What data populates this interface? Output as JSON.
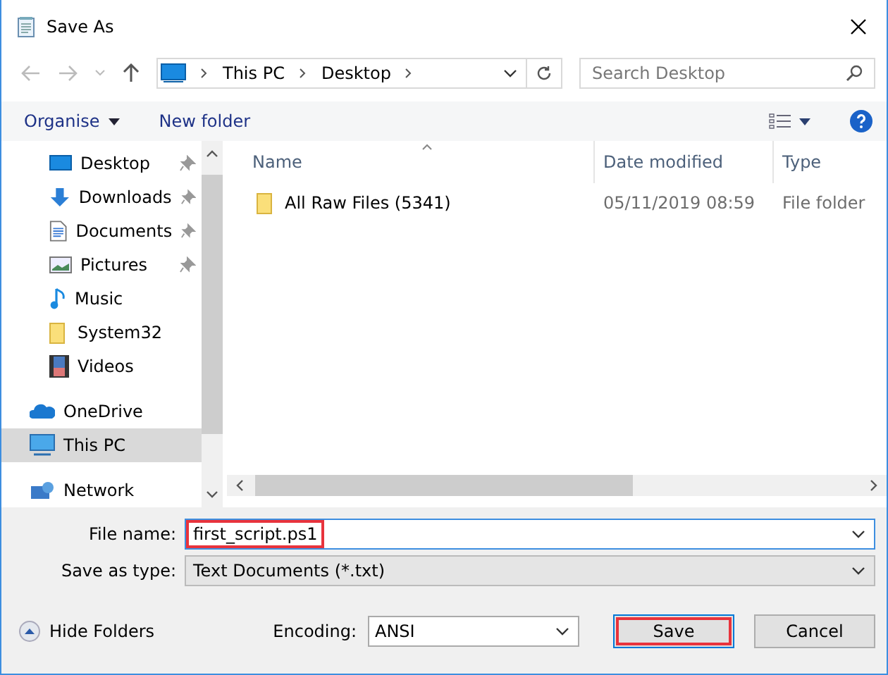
{
  "window": {
    "title": "Save As"
  },
  "address": {
    "crumbs": [
      "This PC",
      "Desktop"
    ],
    "search_placeholder": "Search Desktop"
  },
  "toolbar": {
    "organise": "Organise",
    "new_folder": "New folder"
  },
  "sidebar": {
    "items": [
      {
        "label": "Desktop",
        "kind": "desktop",
        "pinned": true,
        "selected": false
      },
      {
        "label": "Downloads",
        "kind": "downloads",
        "pinned": true,
        "selected": false
      },
      {
        "label": "Documents",
        "kind": "documents",
        "pinned": true,
        "selected": false
      },
      {
        "label": "Pictures",
        "kind": "pictures",
        "pinned": true,
        "selected": false
      },
      {
        "label": "Music",
        "kind": "music",
        "pinned": false,
        "selected": false
      },
      {
        "label": "System32",
        "kind": "folder",
        "pinned": false,
        "selected": false
      },
      {
        "label": "Videos",
        "kind": "videos",
        "pinned": false,
        "selected": false
      },
      {
        "label": "OneDrive",
        "kind": "onedrive",
        "pinned": false,
        "selected": false
      },
      {
        "label": "This PC",
        "kind": "pc",
        "pinned": false,
        "selected": true
      },
      {
        "label": "Network",
        "kind": "network",
        "pinned": false,
        "selected": false
      }
    ]
  },
  "table": {
    "columns": [
      "Name",
      "Date modified",
      "Type"
    ],
    "rows": [
      {
        "name": "All Raw Files (5341)",
        "date": "05/11/2019 08:59",
        "type": "File folder"
      }
    ]
  },
  "form": {
    "file_name_label": "File name:",
    "file_name": "first_script.ps1",
    "file_name_highlighted": true,
    "type_label": "Save as type:",
    "type": "Text Documents (*.txt)"
  },
  "footer": {
    "hide_folders": "Hide Folders",
    "encoding_label": "Encoding:",
    "encoding": "ANSI",
    "buttons": [
      {
        "label": "Save",
        "highlighted": true
      },
      {
        "label": "Cancel",
        "highlighted": false
      }
    ]
  }
}
